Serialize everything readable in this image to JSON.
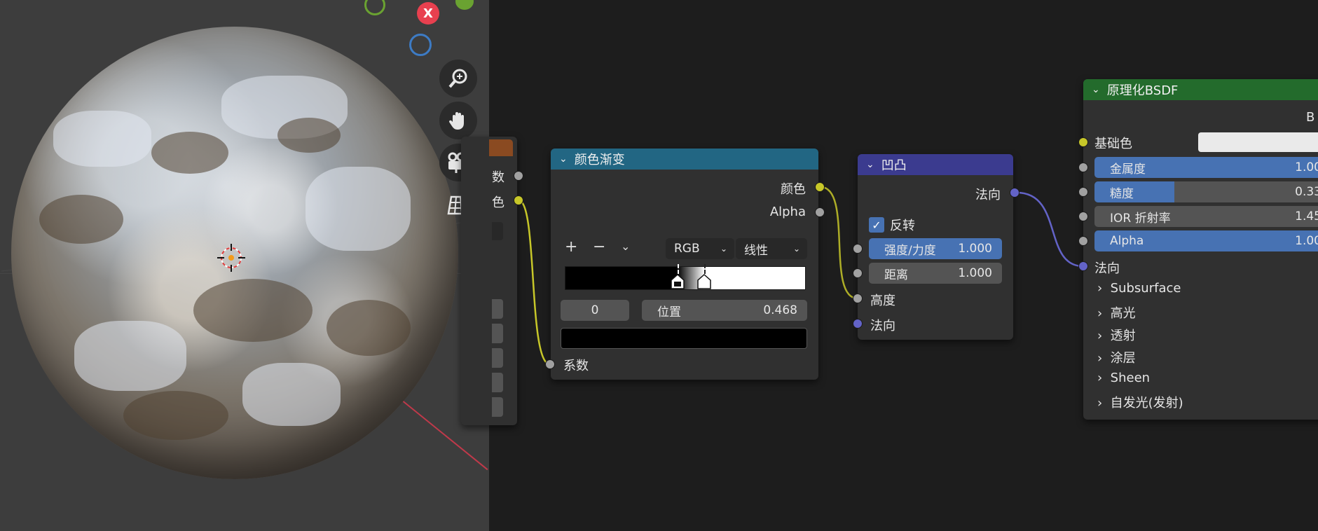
{
  "viewport": {
    "gizmo_x_label": "X",
    "colors": {
      "x_axis": "#e8404f",
      "y_axis": "#6aa231",
      "z_axis": "#3d7bc4",
      "background": "#3d3d3d"
    },
    "nav_icons": [
      "zoom-icon",
      "hand-icon",
      "camera-icon",
      "grid-icon"
    ]
  },
  "partial_node": {
    "rows": [
      "数",
      "色"
    ]
  },
  "color_ramp": {
    "title": "颜色渐变",
    "outputs": {
      "color": "颜色",
      "alpha": "Alpha"
    },
    "color_mode": "RGB",
    "interpolation": "线性",
    "stop_index": "0",
    "position_label": "位置",
    "position_value": "0.468",
    "stops": [
      0.468,
      0.58
    ],
    "input": "系数"
  },
  "bump": {
    "title": "凹凸",
    "output": "法向",
    "invert_label": "反转",
    "invert_checked": true,
    "strength_label": "强度/力度",
    "strength_value": "1.000",
    "distance_label": "距离",
    "distance_value": "1.000",
    "inputs": {
      "height": "高度",
      "normal": "法向"
    }
  },
  "bsdf": {
    "title": "原理化BSDF",
    "output_partial": "B",
    "base_color_label": "基础色",
    "metallic_label": "金属度",
    "metallic_value": "1.00",
    "metallic_fill": 1.0,
    "roughness_label": "糙度",
    "roughness_value": "0.33",
    "roughness_fill": 0.33,
    "ior_label": "IOR 折射率",
    "ior_value": "1.45",
    "alpha_label": "Alpha",
    "alpha_value": "1.00",
    "alpha_fill": 1.0,
    "normal_label": "法向",
    "panels": [
      "Subsurface",
      "高光",
      "透射",
      "涂层",
      "Sheen",
      "自发光(发射)"
    ]
  },
  "colors": {
    "color_ramp_header": "#226683",
    "bump_header": "#3b3b8f",
    "bsdf_header": "#236b2c",
    "field_blue": "#4772b3",
    "socket_yellow": "#c7c729",
    "socket_gray": "#a1a1a1",
    "socket_purple": "#6363c7"
  }
}
